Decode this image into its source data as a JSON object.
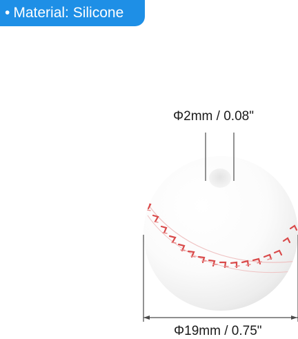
{
  "badge": {
    "bullet": "•",
    "text": "Material: Silicone",
    "color": "#1e8fe6"
  },
  "dimensions": {
    "hole": "Φ2mm / 0.08\"",
    "diameter": "Φ19mm / 0.75\""
  },
  "product": {
    "icon": "baseball-bead-icon",
    "stitch_color": "#d94a4a"
  }
}
